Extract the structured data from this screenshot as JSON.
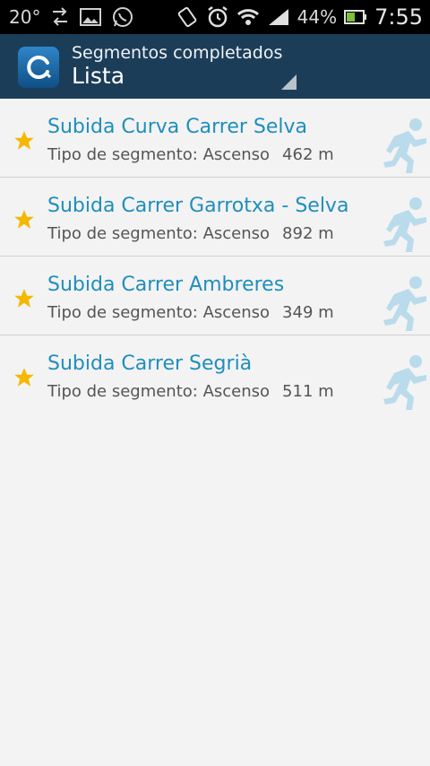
{
  "status_bar": {
    "temperature": "20°",
    "battery_percent": "44%",
    "time": "7:55",
    "icons": [
      "data-transfer-icon",
      "gallery-icon",
      "whatsapp-icon",
      "rotate-icon",
      "alarm-icon",
      "wifi-icon",
      "signal-icon",
      "battery-icon"
    ]
  },
  "action_bar": {
    "subtitle": "Segmentos completados",
    "title": "Lista",
    "accent_color": "#1c3d58"
  },
  "segments": [
    {
      "name": "Subida Curva Carrer Selva",
      "type_label": "Tipo de segmento: Ascenso",
      "distance": "462 m",
      "starred": true
    },
    {
      "name": "Subida Carrer Garrotxa - Selva",
      "type_label": "Tipo de segmento: Ascenso",
      "distance": "892 m",
      "starred": true
    },
    {
      "name": "Subida Carrer Ambreres",
      "type_label": "Tipo de segmento: Ascenso",
      "distance": "349 m",
      "starred": true
    },
    {
      "name": "Subida Carrer Segrià",
      "type_label": "Tipo de segmento: Ascenso",
      "distance": "511 m",
      "starred": true
    }
  ],
  "colors": {
    "title_link": "#1f8ebc",
    "star": "#f5b800",
    "runner": "#b9dbeb"
  }
}
